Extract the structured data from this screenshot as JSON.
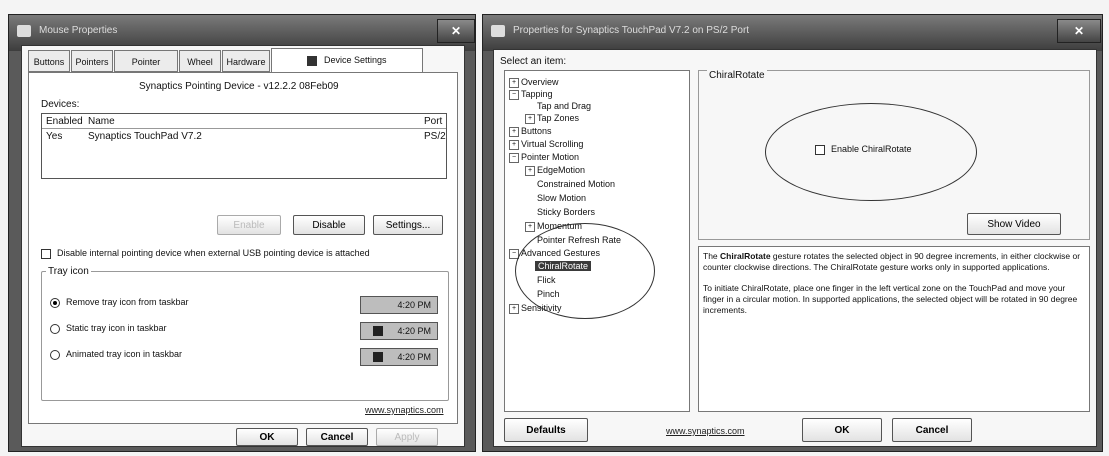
{
  "left_window": {
    "title": "Mouse Properties",
    "close_label": "✕",
    "tabs": [
      "Buttons",
      "Pointers",
      "Pointer Options",
      "Wheel",
      "Hardware",
      "Device Settings"
    ],
    "device_title": "Synaptics Pointing Device - v12.2.2 08Feb09",
    "devices_label": "Devices:",
    "columns": [
      "Enabled",
      "Name",
      "Port"
    ],
    "rows": [
      [
        "Yes",
        "Synaptics TouchPad V7.2",
        "PS/2"
      ]
    ],
    "buttons": {
      "enable": "Enable",
      "disable": "Disable",
      "settings": "Settings..."
    },
    "disable_internal": "Disable internal pointing device when external USB pointing device is attached",
    "tray_group": "Tray icon",
    "tray_options": [
      "Remove tray icon from taskbar",
      "Static tray icon in taskbar",
      "Animated tray icon in taskbar"
    ],
    "tray_selected": 0,
    "tray_time": "4:20 PM",
    "link": "www.synaptics.com",
    "bottom_buttons": {
      "ok": "OK",
      "cancel": "Cancel",
      "apply": "Apply"
    }
  },
  "right_window": {
    "title": "Properties for Synaptics TouchPad V7.2 on PS/2 Port",
    "close_label": "✕",
    "select_label": "Select an item:",
    "tree": {
      "overview": "Overview",
      "tapping": "Tapping",
      "tap_and_drag": "Tap and Drag",
      "tap_zones": "Tap Zones",
      "buttons": "Buttons",
      "virtual_scrolling": "Virtual Scrolling",
      "pointer_motion": "Pointer Motion",
      "edge_motion": "EdgeMotion",
      "constrained_motion": "Constrained Motion",
      "slow_motion": "Slow Motion",
      "sticky_borders": "Sticky Borders",
      "momentum": "Momentum",
      "pointer_refresh_rate": "Pointer Refresh Rate",
      "advanced_gestures": "Advanced Gestures",
      "chiral_rotate": "ChiralRotate",
      "flick": "Flick",
      "pinch": "Pinch",
      "sensitivity": "Sensitivity"
    },
    "group_title": "ChiralRotate",
    "enable_label": "Enable ChiralRotate",
    "show_video": "Show Video",
    "desc1_bold": "ChiralRotate",
    "desc1_pre": "The ",
    "desc1_post": " gesture rotates the selected object in 90 degree increments, in either clockwise or counter clockwise directions. The ChiralRotate gesture works only in supported applications.",
    "desc2": "To initiate ChiralRotate, place one finger in the left vertical zone on the TouchPad and move your finger in a circular motion. In supported applications, the selected object will be rotated in 90 degree increments.",
    "defaults": "Defaults",
    "link": "www.synaptics.com",
    "ok": "OK",
    "cancel": "Cancel"
  }
}
